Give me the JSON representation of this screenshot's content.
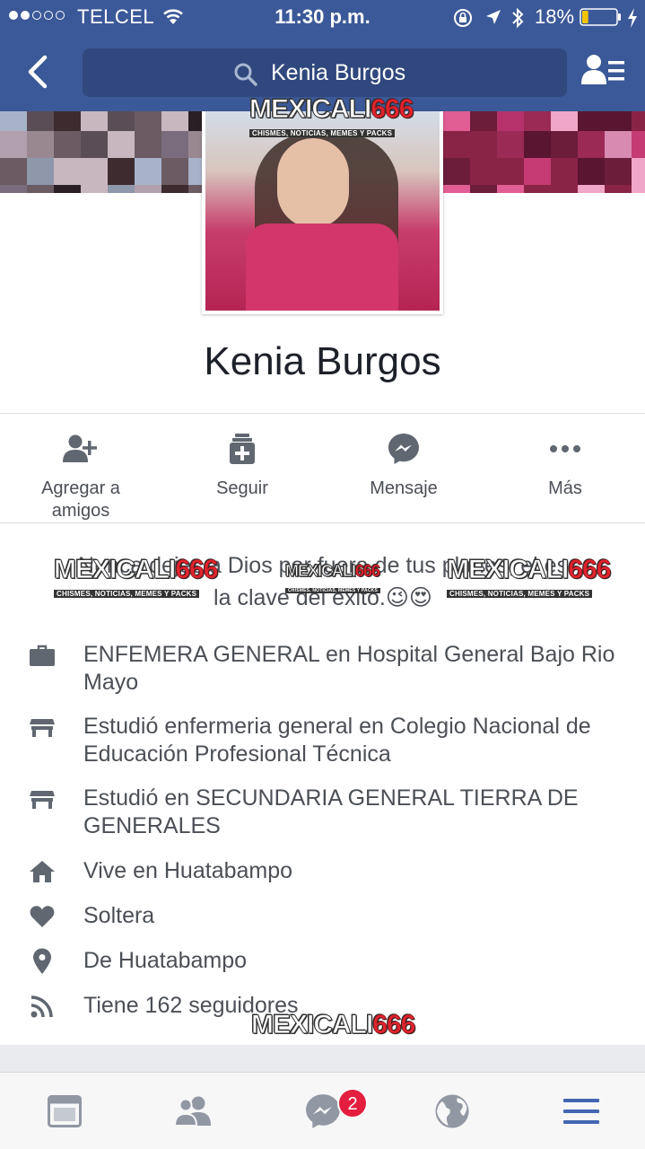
{
  "status_bar": {
    "carrier": "TELCEL",
    "time": "11:30 p.m.",
    "battery_percent": "18%",
    "battery_level": 0.18,
    "signal_bars_filled": 2,
    "signal_bars_total": 5
  },
  "nav": {
    "search_value": "Kenia Burgos"
  },
  "profile": {
    "name": "Kenia Burgos"
  },
  "actions": {
    "add_friend": "Agregar a amigos",
    "follow": "Seguir",
    "message": "Mensaje",
    "more": "Más"
  },
  "bio": {
    "line1": "Nunca dejes a Dios por fuera de tus planes, el es",
    "line2": "la clave del éxito.😉😍"
  },
  "info": {
    "items": [
      {
        "icon": "briefcase-icon",
        "text": "ENFEMERA GENERAL en Hospital General Bajo Rio Mayo"
      },
      {
        "icon": "school-icon",
        "text": "Estudió enfermeria general en Colegio Nacional de Educación Profesional Técnica"
      },
      {
        "icon": "school-icon",
        "text": "Estudió en SECUNDARIA GENERAL TIERRA DE GENERALES"
      },
      {
        "icon": "home-icon",
        "text": "Vive en Huatabampo"
      },
      {
        "icon": "heart-icon",
        "text": "Soltera"
      },
      {
        "icon": "location-pin-icon",
        "text": "De Huatabampo"
      },
      {
        "icon": "rss-icon",
        "text": "Tiene 162 seguidores"
      }
    ]
  },
  "watermark": {
    "brand": "MEXICALI",
    "number": "666",
    "tagline": "CHISMES, NOTICIAS, MEMES Y PACKS"
  },
  "tabbar": {
    "messenger_badge": "2"
  },
  "colors": {
    "facebook_blue": "#3b5998",
    "search_bg": "#30487d",
    "badge_red": "#e41e3f",
    "menu_active": "#4267b2",
    "icon_gray": "#4b4f56"
  }
}
